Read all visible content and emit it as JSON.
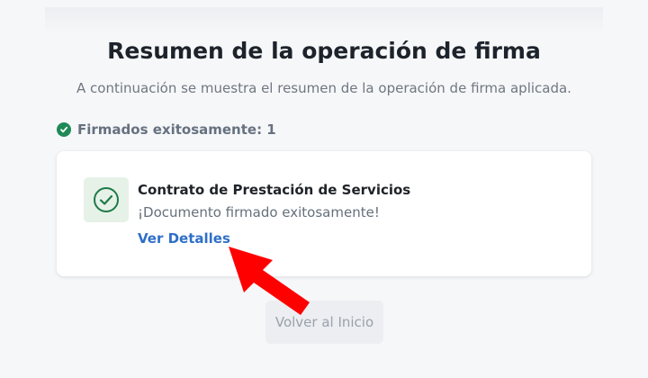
{
  "title": "Resumen de la operación de firma",
  "subtitle": "A continuación se muestra el resumen de la operación de firma aplicada.",
  "status": {
    "label": "Firmados exitosamente: 1",
    "color": "#1f8a58"
  },
  "document": {
    "title": "Contrato de Prestación de Servicios",
    "message": "¡Documento firmado exitosamente!",
    "details_link": "Ver Detalles",
    "icon": "check-circle-icon"
  },
  "back_button": "Volver al Inicio",
  "annotation": {
    "arrow_color": "#ff0000",
    "points_to": "Ver Detalles"
  }
}
